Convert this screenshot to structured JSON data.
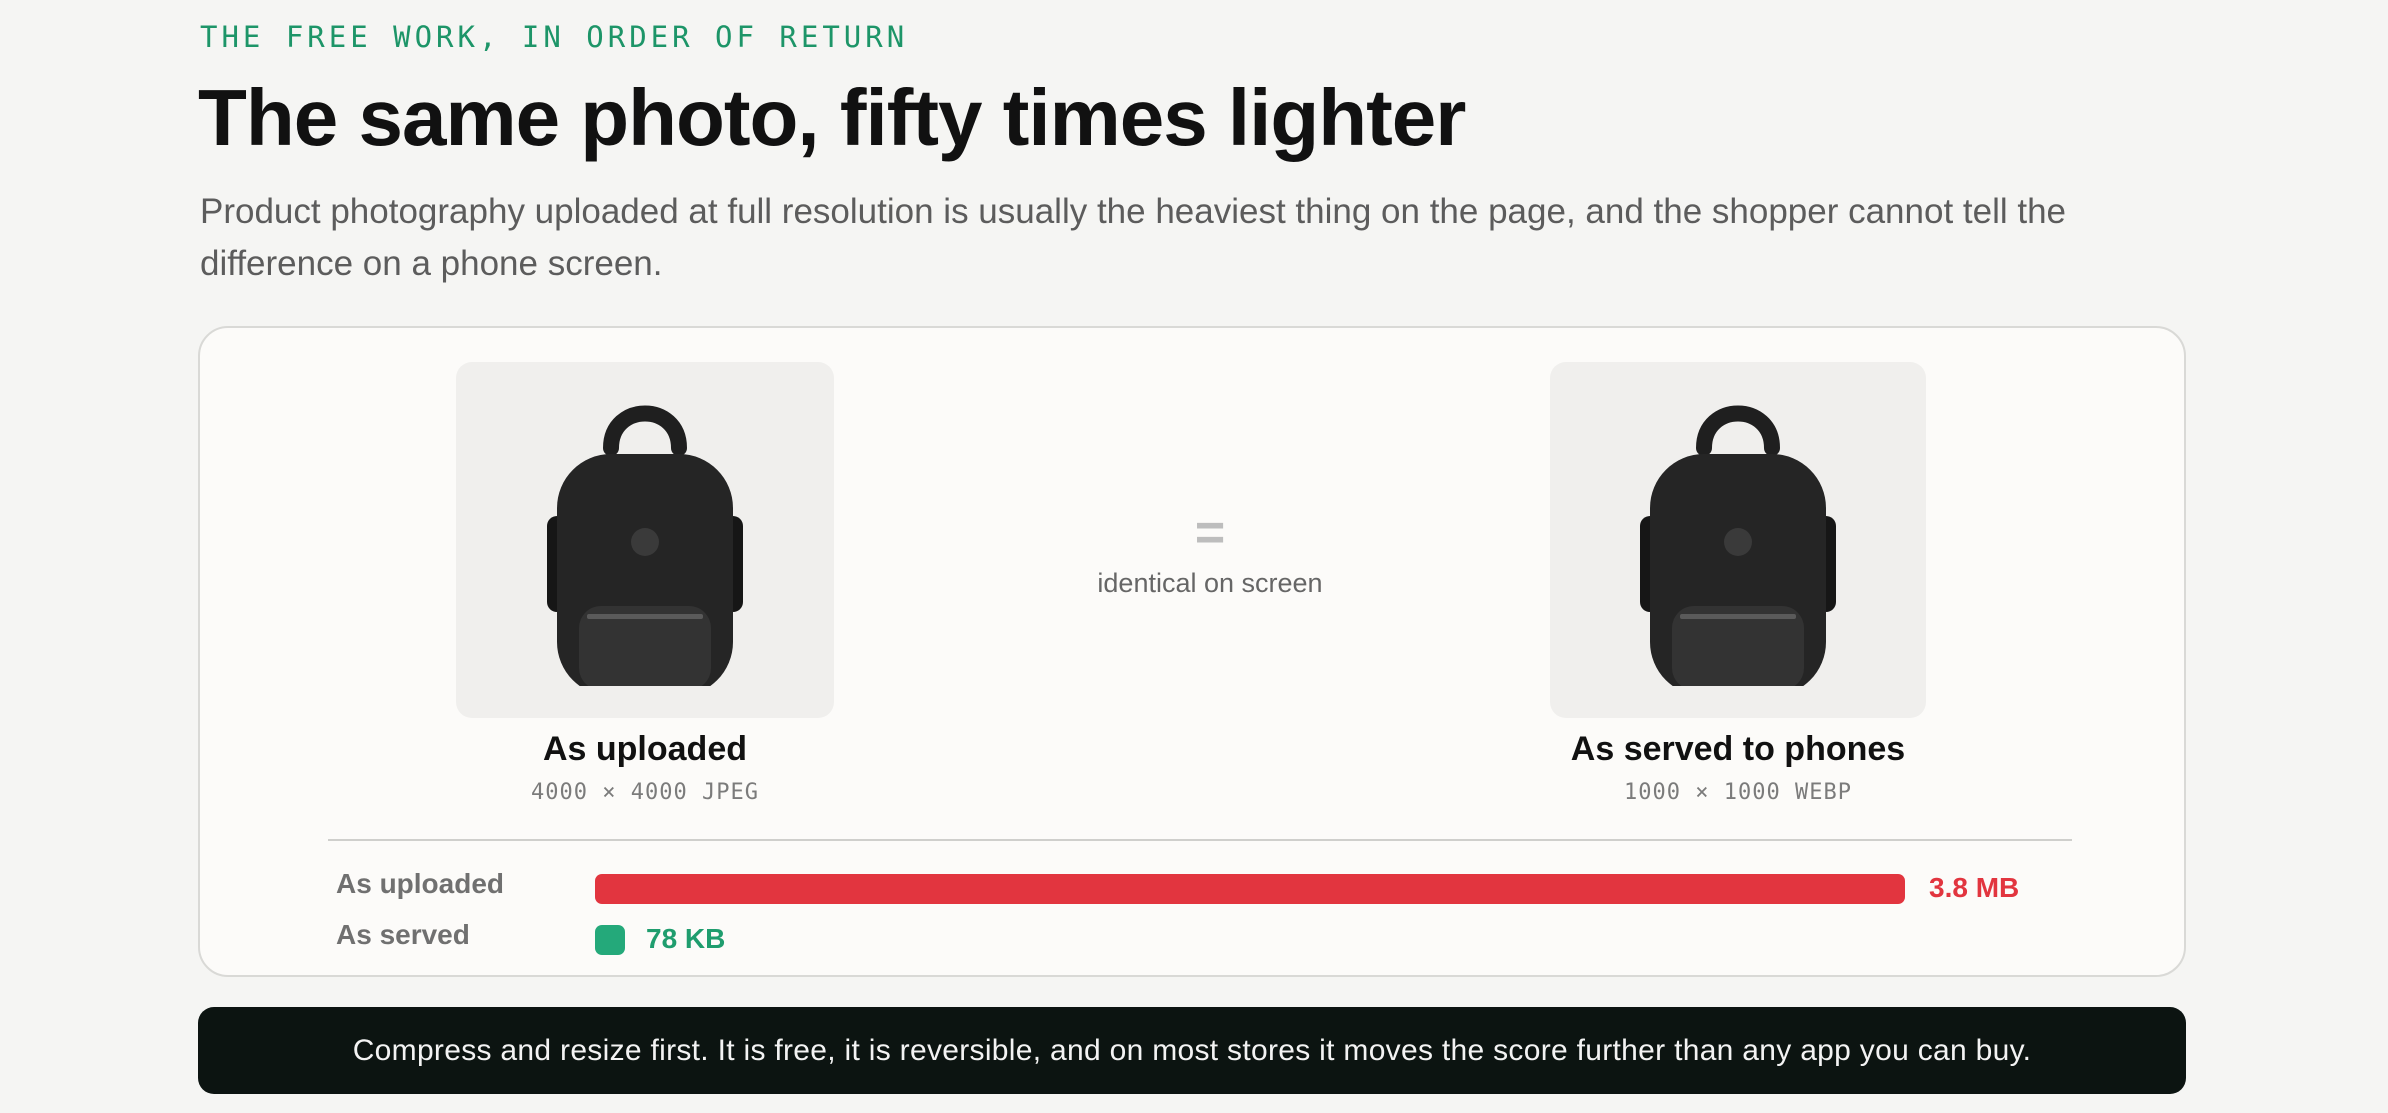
{
  "eyebrow": "THE FREE WORK, IN ORDER OF RETURN",
  "headline": "The same photo, fifty times lighter",
  "lede": "Product photography uploaded at full resolution is usually the heaviest thing on the page, and the shopper cannot tell the difference on a phone screen.",
  "comparison": {
    "left": {
      "title": "As uploaded",
      "spec": "4000 × 4000 JPEG",
      "icon": "backpack-icon"
    },
    "middle": {
      "symbol": "=",
      "caption": "identical on screen"
    },
    "right": {
      "title": "As served to phones",
      "spec": "1000 × 1000 WEBP",
      "icon": "backpack-icon"
    }
  },
  "sizes": {
    "rows": [
      {
        "label": "As uploaded",
        "value_text": "3.8 MB",
        "kilobytes": 3800,
        "color": "#e2353f"
      },
      {
        "label": "As served",
        "value_text": "78 KB",
        "kilobytes": 78,
        "color": "#24a97a"
      }
    ]
  },
  "banner": "Compress and resize first. It is free, it is reversible, and on most stores it moves the score further than any app you can buy.",
  "colors": {
    "accent_green": "#1d9568",
    "alert_red": "#e2353f",
    "banner_bg": "#0c1411"
  }
}
